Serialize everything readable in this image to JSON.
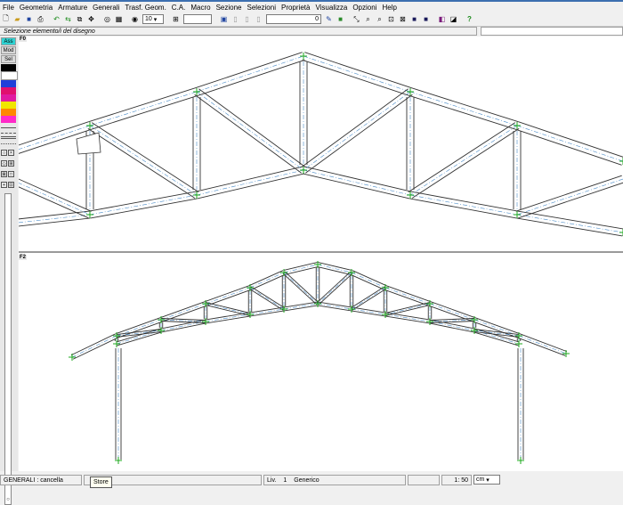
{
  "menu": [
    "File",
    "Geometria",
    "Armature",
    "Generali",
    "Trasf. Geom.",
    "C.A.",
    "Macro",
    "Sezione",
    "Selezioni",
    "Proprietà",
    "Visualizza",
    "Opzioni",
    "Help"
  ],
  "toolbar": {
    "combo_value": "10",
    "angle_value": "0"
  },
  "selection_message": "Selezione elemento/i del disegno",
  "left_panel": {
    "buttons": [
      "Ass",
      "Mod",
      "Sel"
    ],
    "swatches": [
      "#000000",
      "#ffffff",
      "#1f3fd9",
      "#e0106e",
      "#e01aa0",
      "#f0e600",
      "#ff8800",
      "#ff2ac8"
    ]
  },
  "panes": {
    "top_label": "F0",
    "bottom_label": "F2"
  },
  "status": {
    "mode": "GENERALI : cancella",
    "tooltip": "Store",
    "level_label": "Liv.",
    "level_value": "1",
    "level_name": "Generico",
    "scale": "1: 50",
    "unit": "cm"
  },
  "colors": {
    "accent_cyan": "#2fd3d3",
    "node_green": "#1ea81e",
    "axis_blue": "#4a8cc9"
  }
}
